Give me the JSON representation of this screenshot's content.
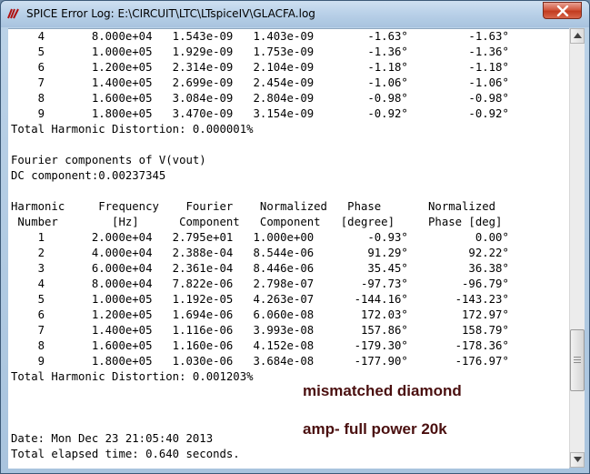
{
  "window": {
    "title": "SPICE Error Log: E:\\CIRCUIT\\LTC\\LTspiceIV\\GLACFA.log",
    "app_icon": "ltspice-logo-icon",
    "close_icon": "close-icon"
  },
  "log": {
    "prev_rows": [
      {
        "n": "4",
        "freq": "8.000e+04",
        "comp": "1.543e-09",
        "norm": "1.403e-09",
        "phase": "-1.63°",
        "nphase": "-1.63°"
      },
      {
        "n": "5",
        "freq": "1.000e+05",
        "comp": "1.929e-09",
        "norm": "1.753e-09",
        "phase": "-1.36°",
        "nphase": "-1.36°"
      },
      {
        "n": "6",
        "freq": "1.200e+05",
        "comp": "2.314e-09",
        "norm": "2.104e-09",
        "phase": "-1.18°",
        "nphase": "-1.18°"
      },
      {
        "n": "7",
        "freq": "1.400e+05",
        "comp": "2.699e-09",
        "norm": "2.454e-09",
        "phase": "-1.06°",
        "nphase": "-1.06°"
      },
      {
        "n": "8",
        "freq": "1.600e+05",
        "comp": "3.084e-09",
        "norm": "2.804e-09",
        "phase": "-0.98°",
        "nphase": "-0.98°"
      },
      {
        "n": "9",
        "freq": "1.800e+05",
        "comp": "3.470e-09",
        "norm": "3.154e-09",
        "phase": "-0.92°",
        "nphase": "-0.92°"
      }
    ],
    "prev_thd": "Total Harmonic Distortion: 0.000001%",
    "fourier_heading": "Fourier components of V(vout)",
    "dc_component": "DC component:0.00237345",
    "header1": "Harmonic     Frequency    Fourier    Normalized   Phase       Normalized",
    "header2": " Number        [Hz]      Component   Component   [degree]     Phase [deg]",
    "rows": [
      {
        "n": "1",
        "freq": "2.000e+04",
        "comp": "2.795e+01",
        "norm": "1.000e+00",
        "phase": "-0.93°",
        "nphase": "0.00°"
      },
      {
        "n": "2",
        "freq": "4.000e+04",
        "comp": "2.388e-04",
        "norm": "8.544e-06",
        "phase": "91.29°",
        "nphase": "92.22°"
      },
      {
        "n": "3",
        "freq": "6.000e+04",
        "comp": "2.361e-04",
        "norm": "8.446e-06",
        "phase": "35.45°",
        "nphase": "36.38°"
      },
      {
        "n": "4",
        "freq": "8.000e+04",
        "comp": "7.822e-06",
        "norm": "2.798e-07",
        "phase": "-97.73°",
        "nphase": "-96.79°"
      },
      {
        "n": "5",
        "freq": "1.000e+05",
        "comp": "1.192e-05",
        "norm": "4.263e-07",
        "phase": "-144.16°",
        "nphase": "-143.23°"
      },
      {
        "n": "6",
        "freq": "1.200e+05",
        "comp": "1.694e-06",
        "norm": "6.060e-08",
        "phase": "172.03°",
        "nphase": "172.97°"
      },
      {
        "n": "7",
        "freq": "1.400e+05",
        "comp": "1.116e-06",
        "norm": "3.993e-08",
        "phase": "157.86°",
        "nphase": "158.79°"
      },
      {
        "n": "8",
        "freq": "1.600e+05",
        "comp": "1.160e-06",
        "norm": "4.152e-08",
        "phase": "-179.30°",
        "nphase": "-178.36°"
      },
      {
        "n": "9",
        "freq": "1.800e+05",
        "comp": "1.030e-06",
        "norm": "3.684e-08",
        "phase": "-177.90°",
        "nphase": "-176.97°"
      }
    ],
    "thd": "Total Harmonic Distortion: 0.001203%",
    "date": "Date: Mon Dec 23 21:05:40 2013",
    "partial_line": "Total elapsed time: 0.640 seconds."
  },
  "annotations": {
    "line1": "mismatched diamond",
    "line2": "amp- full power 20k",
    "color": "#4a0f0f"
  },
  "scrollbar": {
    "up_icon": "arrow-up-icon",
    "down_icon": "arrow-down-icon"
  }
}
